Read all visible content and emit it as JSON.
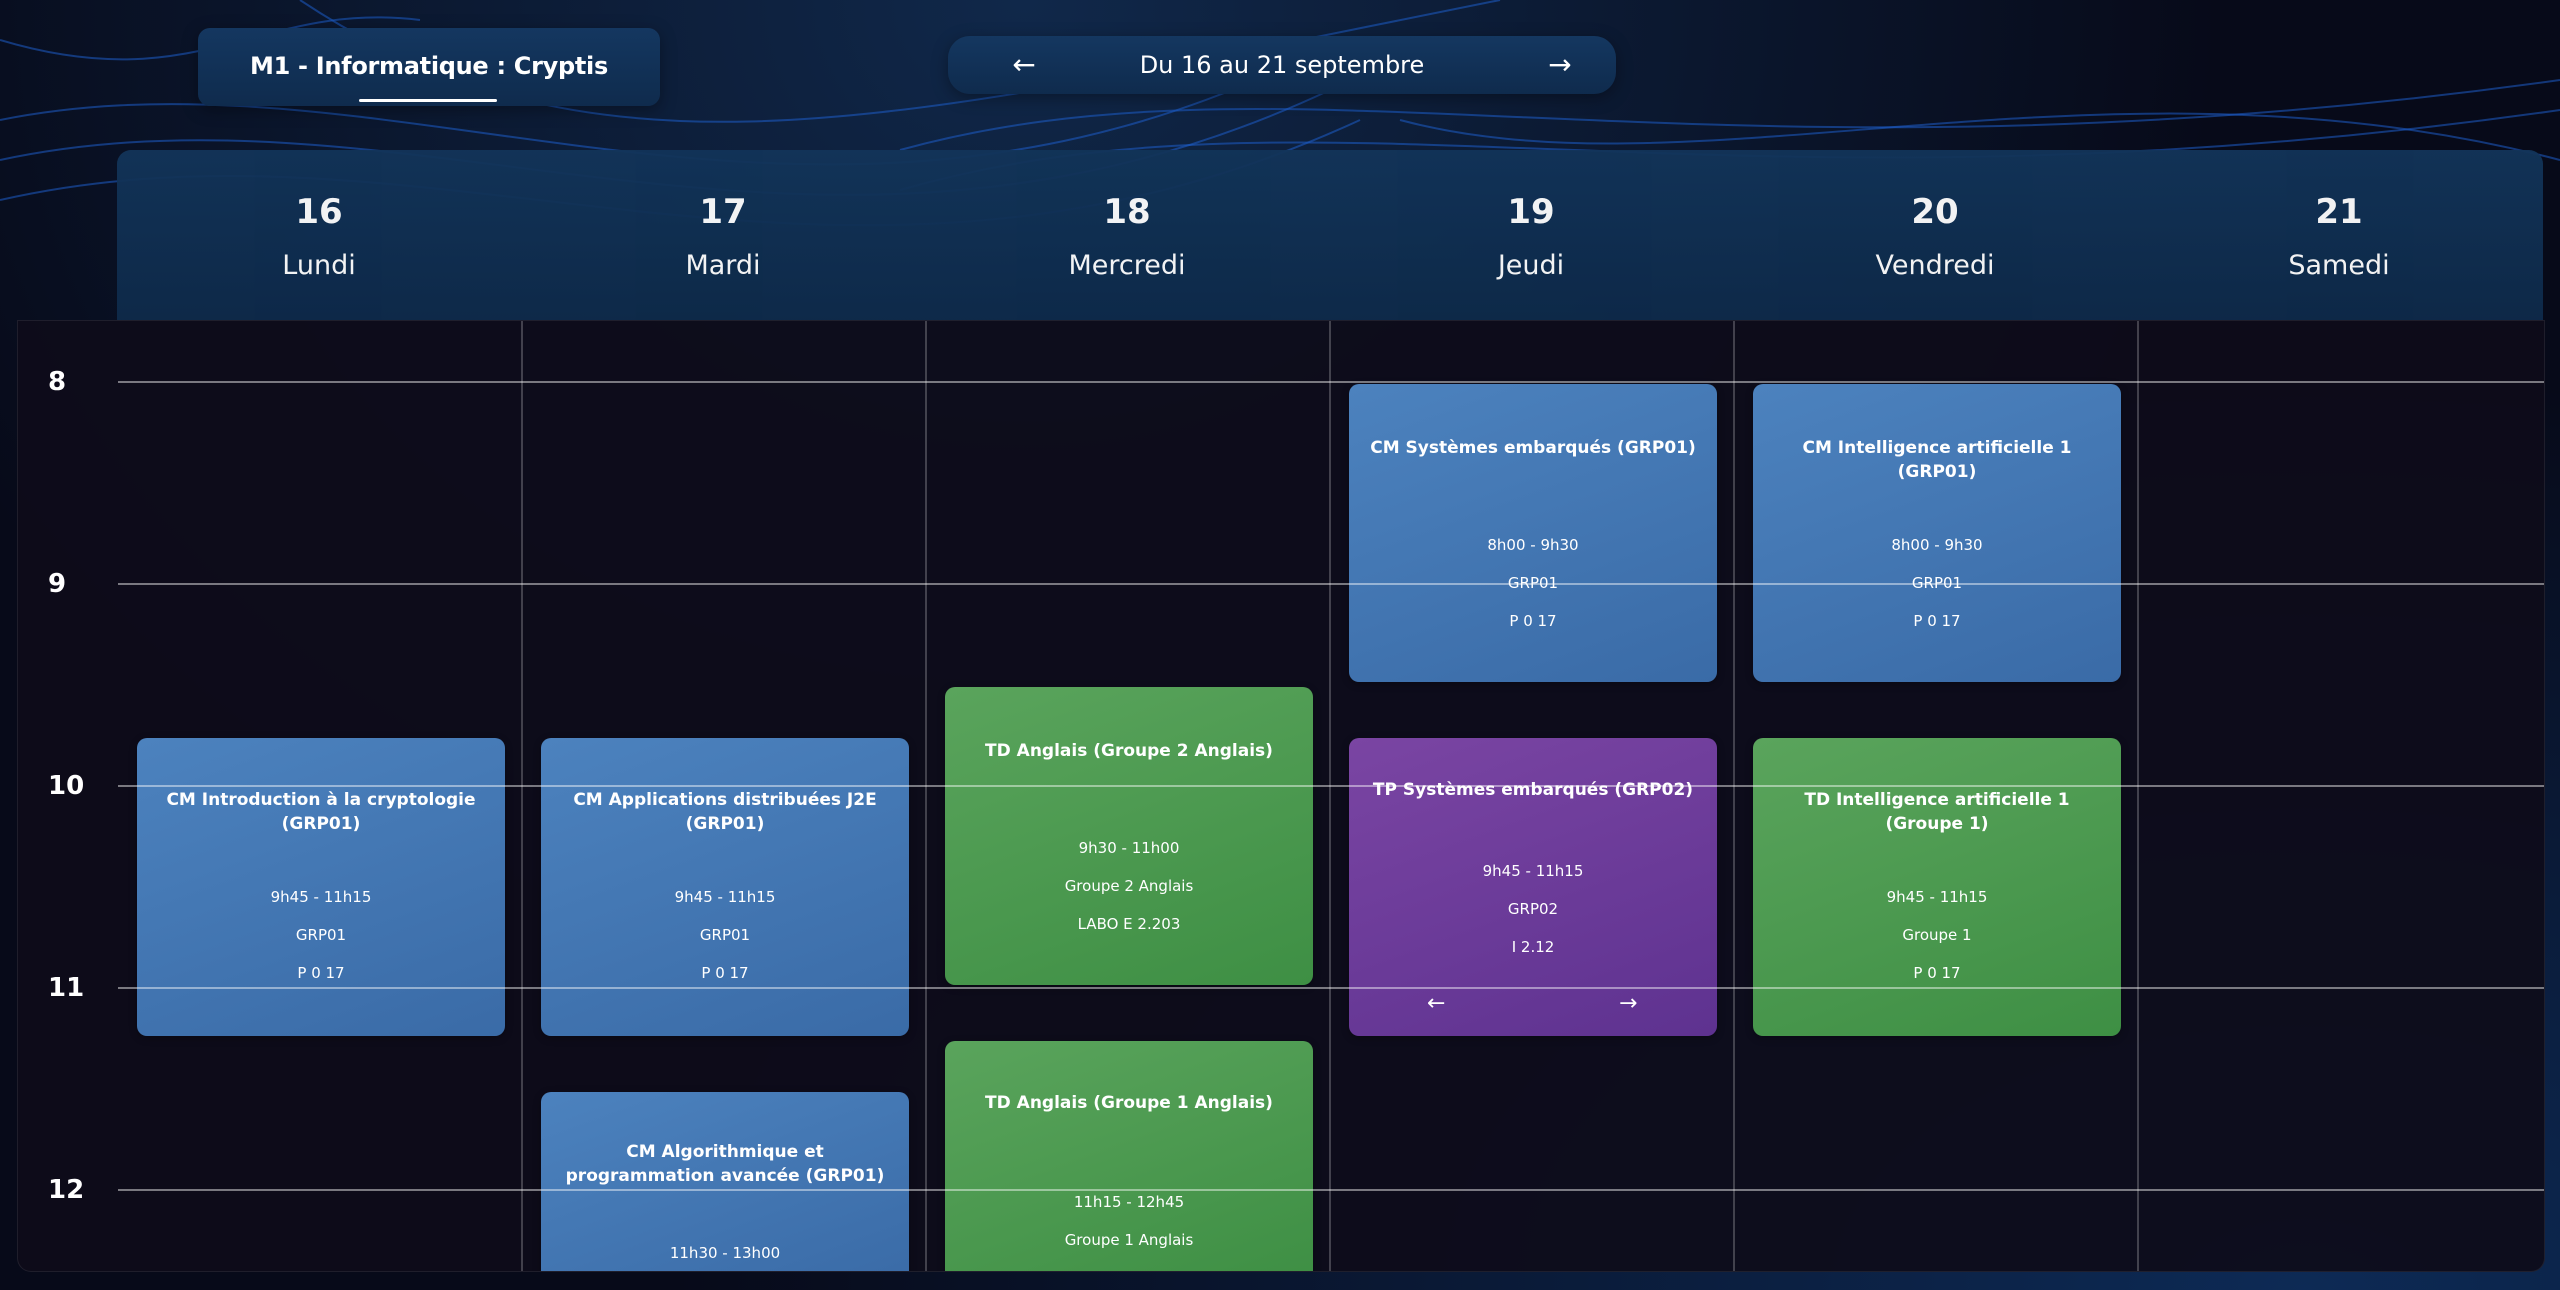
{
  "program": {
    "label": "M1 - Informatique : Cryptis"
  },
  "week_nav": {
    "label": "Du 16 au 21 septembre",
    "prev_icon": "arrow-left-icon",
    "next_icon": "arrow-right-icon",
    "prev_glyph": "←",
    "next_glyph": "→"
  },
  "days": [
    {
      "num": "16",
      "name": "Lundi"
    },
    {
      "num": "17",
      "name": "Mardi"
    },
    {
      "num": "18",
      "name": "Mercredi"
    },
    {
      "num": "19",
      "name": "Jeudi"
    },
    {
      "num": "20",
      "name": "Vendredi"
    },
    {
      "num": "21",
      "name": "Samedi"
    }
  ],
  "hours": [
    "8",
    "9",
    "10",
    "11",
    "12"
  ],
  "colors": {
    "blue": "#4577b3",
    "green": "#4a9a4e",
    "purple": "#6c3c9a",
    "background": "#070a19"
  },
  "events": [
    {
      "title": "CM Introduction à la cryptologie (GRP01)",
      "time": "9h45 - 11h15",
      "group": "GRP01",
      "room": "P 0 17"
    },
    {
      "title": "CM Applications distribuées J2E (GRP01)",
      "time": "9h45 - 11h15",
      "group": "GRP01",
      "room": "P 0 17"
    },
    {
      "title": "CM Algorithmique et programmation avancée (GRP01)",
      "time": "11h30 - 13h00"
    },
    {
      "title": "TD Anglais (Groupe 2 Anglais)",
      "time": "9h30 - 11h00",
      "group": "Groupe 2 Anglais",
      "room": "LABO E 2.203"
    },
    {
      "title": "TD Anglais (Groupe 1 Anglais)",
      "time": "11h15 - 12h45",
      "group": "Groupe 1 Anglais"
    },
    {
      "title": "CM Systèmes embarqués (GRP01)",
      "time": "8h00 - 9h30",
      "group": "GRP01",
      "room": "P 0 17"
    },
    {
      "title": "TP Systèmes embarqués (GRP02)",
      "time": "9h45 - 11h15",
      "group": "GRP02",
      "room": "I 2.12",
      "prev_glyph": "←",
      "next_glyph": "→"
    },
    {
      "title": "CM Intelligence artificielle 1 (GRP01)",
      "time": "8h00 - 9h30",
      "group": "GRP01",
      "room": "P 0 17"
    },
    {
      "title": "TD Intelligence artificielle 1 (Groupe 1)",
      "time": "9h45 - 11h15",
      "group": "Groupe 1",
      "room": "P 0 17"
    }
  ]
}
